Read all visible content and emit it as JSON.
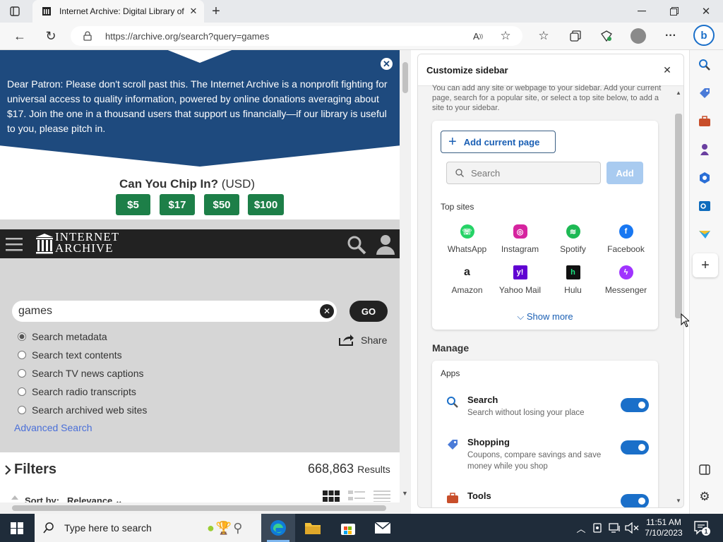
{
  "browser": {
    "tab_title": "Internet Archive: Digital Library of Free & Borrowable Books, Movies, Music & Wayback Machine",
    "url": "https://archive.org/search?query=games",
    "accent": "#1a6fc9"
  },
  "banner": {
    "text": "Dear Patron: Please don't scroll past this. The Internet Archive is a nonprofit fighting for universal access to quality information, powered by online donations averaging about $17. Join the one in a thousand users that support us financially—if our library is useful to you, please pitch in.",
    "chip_title": "Can You Chip In?",
    "chip_currency": "(USD)",
    "amounts": [
      "$5",
      "$17",
      "$50",
      "$100"
    ]
  },
  "ia": {
    "logo_line1": "INTERNET",
    "logo_line2": "ARCHIVE",
    "search_value": "games",
    "go_label": "GO",
    "share_label": "Share",
    "options": [
      "Search metadata",
      "Search text contents",
      "Search TV news captions",
      "Search radio transcripts",
      "Search archived web sites"
    ],
    "advanced_label": "Advanced Search",
    "filters_label": "Filters",
    "results_count": "668,863",
    "results_label": "Results",
    "sort_label": "Sort by:",
    "sort_value": "Relevance"
  },
  "sidebar": {
    "title": "Customize sidebar",
    "intro": "You can add any site or webpage to your sidebar. Add your current page, search for a popular site, or select a top site below, to add a site to your sidebar.",
    "add_current_label": "Add current page",
    "search_placeholder": "Search",
    "add_label": "Add",
    "top_sites_label": "Top sites",
    "top_sites": [
      {
        "name": "WhatsApp",
        "color": "#25d366"
      },
      {
        "name": "Instagram",
        "color": "#d6249f"
      },
      {
        "name": "Spotify",
        "color": "#1db954"
      },
      {
        "name": "Facebook",
        "color": "#1877f2"
      },
      {
        "name": "Amazon",
        "color": "#222222"
      },
      {
        "name": "Yahoo Mail",
        "color": "#6001d2"
      },
      {
        "name": "Hulu",
        "color": "#111111"
      },
      {
        "name": "Messenger",
        "color": "#a033ff"
      }
    ],
    "show_more_label": "Show more",
    "manage_label": "Manage",
    "apps_label": "Apps",
    "apps": [
      {
        "name": "Search",
        "desc": "Search without losing your place",
        "enabled": true
      },
      {
        "name": "Shopping",
        "desc": "Coupons, compare savings and save money while you shop",
        "enabled": true
      },
      {
        "name": "Tools",
        "desc": "",
        "enabled": true
      }
    ]
  },
  "taskbar": {
    "search_placeholder": "Type here to search",
    "time": "11:51 AM",
    "date": "7/10/2023",
    "notification_count": "1"
  }
}
